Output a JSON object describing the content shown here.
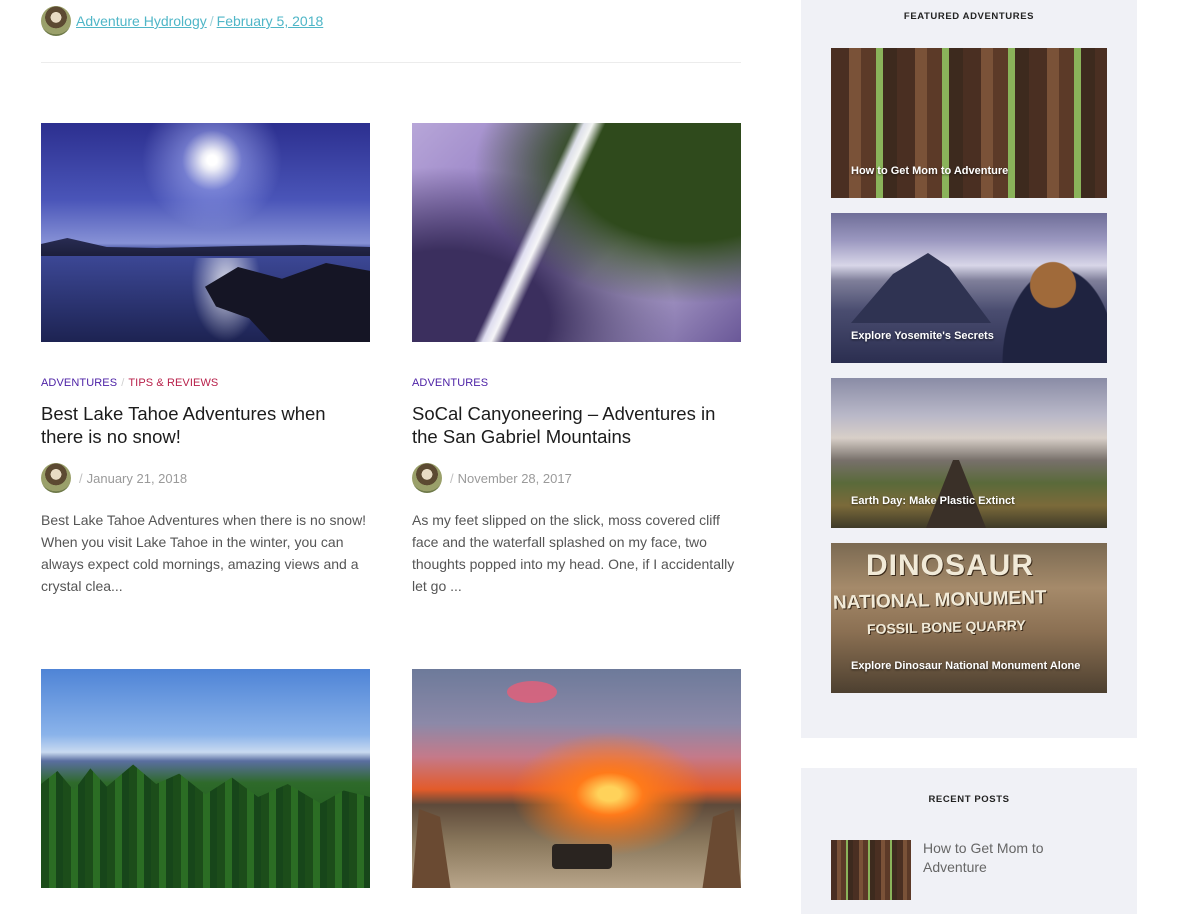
{
  "header": {
    "author": "Adventure Hydrology",
    "date": "February 5, 2018"
  },
  "posts": [
    {
      "categories": [
        "ADVENTURES",
        "TIPS & REVIEWS"
      ],
      "title": "Best Lake Tahoe Adventures when there is no snow!",
      "date": "January 21, 2018",
      "excerpt": "Best Lake Tahoe Adventures when there is no snow! When you visit Lake Tahoe in the winter, you can always expect cold mornings, amazing views and a crystal clea..."
    },
    {
      "categories": [
        "ADVENTURES"
      ],
      "title": "SoCal Canyoneering – Adventures in the San Gabriel Mountains",
      "date": "November 28, 2017",
      "excerpt": "As my feet slipped on the slick, moss covered cliff face and the waterfall splashed on my face, two thoughts popped into my head. One, if I accidentally let go ..."
    }
  ],
  "sidebar": {
    "featured_title": "FEATURED ADVENTURES",
    "featured": [
      "How to Get Mom to Adventure",
      "Explore Yosemite's Secrets",
      "Earth Day: Make Plastic Extinct",
      "Explore Dinosaur National Monument Alone"
    ],
    "dino_sign": [
      "DINOSAUR",
      "NATIONAL MONUMENT",
      "FOSSIL BONE QUARRY"
    ],
    "recent_title": "RECENT POSTS",
    "recent": [
      "How to Get Mom to Adventure"
    ]
  },
  "colors": {
    "link": "#4fb6c7",
    "category_adventures": "#4b1fa5",
    "category_tips": "#b8204a",
    "sidebar_bg": "#f0f1f6"
  }
}
